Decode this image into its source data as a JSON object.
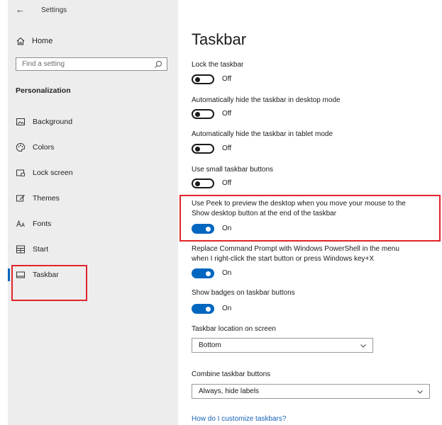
{
  "window": {
    "back_icon": "←",
    "title": "Settings"
  },
  "sidebar": {
    "home_label": "Home",
    "search": {
      "placeholder": "Find a setting",
      "value": ""
    },
    "section_heading": "Personalization",
    "items": [
      {
        "label": "Background",
        "icon": "background-icon"
      },
      {
        "label": "Colors",
        "icon": "palette-icon"
      },
      {
        "label": "Lock screen",
        "icon": "lock-screen-icon"
      },
      {
        "label": "Themes",
        "icon": "themes-icon"
      },
      {
        "label": "Fonts",
        "icon": "fonts-icon"
      },
      {
        "label": "Start",
        "icon": "start-icon"
      },
      {
        "label": "Taskbar",
        "icon": "taskbar-icon",
        "selected": true
      }
    ]
  },
  "main": {
    "title": "Taskbar",
    "settings": [
      {
        "label": "Lock the taskbar",
        "state": "Off"
      },
      {
        "label": "Automatically hide the taskbar in desktop mode",
        "state": "Off"
      },
      {
        "label": "Automatically hide the taskbar in tablet mode",
        "state": "Off"
      },
      {
        "label": "Use small taskbar buttons",
        "state": "Off"
      },
      {
        "label_line1": "Use Peek to preview the desktop when you move your mouse to the",
        "label_line2": "Show desktop button at the end of the taskbar",
        "state": "On"
      },
      {
        "label_line1": "Replace Command Prompt with Windows PowerShell in the menu",
        "label_line2": "when I right-click the start button or press Windows key+X",
        "state": "On"
      },
      {
        "label": "Show badges on taskbar buttons",
        "state": "On"
      }
    ],
    "location": {
      "label": "Taskbar location on screen",
      "value": "Bottom"
    },
    "combine": {
      "label": "Combine taskbar buttons",
      "value": "Always, hide labels"
    },
    "help_link": "How do I customize taskbars?"
  },
  "colors": {
    "accent": "#0067c0",
    "highlight_border": "#e0242b",
    "sidebar_bg": "#ededed",
    "link": "#1860b8"
  }
}
